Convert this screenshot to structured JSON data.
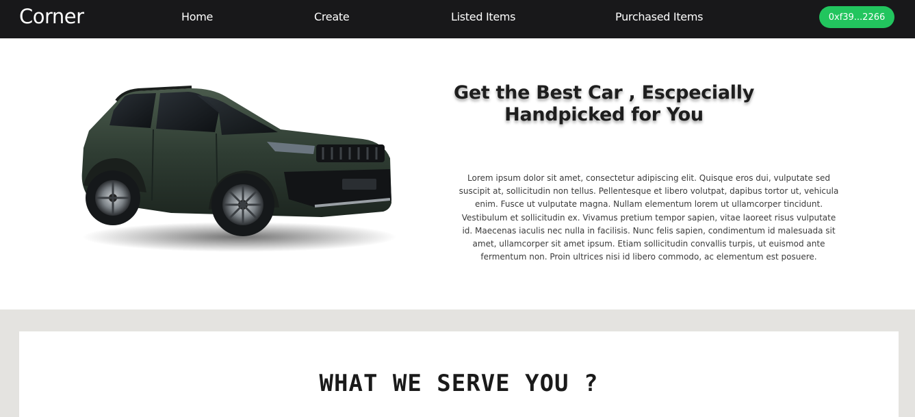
{
  "nav": {
    "brand": "Corner",
    "links": [
      "Home",
      "Create",
      "Listed Items",
      "Purchased Items"
    ],
    "wallet": "0xf39...2266",
    "accent_color": "#22c55e"
  },
  "hero": {
    "title": "Get the Best Car , Escpecially Handpicked for You",
    "image_icon": "suv-car-image",
    "body": "Lorem ipsum dolor sit amet, consectetur adipiscing elit. Quisque eros dui, vulputate sed suscipit at, sollicitudin non tellus. Pellentesque et libero volutpat, dapibus tortor ut, vehicula enim. Fusce ut vulputate magna. Nullam elementum lorem ut ullamcorper tincidunt. Vestibulum et sollicitudin ex. Vivamus pretium tempor sapien, vitae laoreet risus vulputate id. Maecenas iaculis nec nulla in facilisis. Nunc felis sapien, condimentum id malesuada sit amet, ullamcorper sit amet ipsum. Etiam sollicitudin convallis turpis, ut euismod ante fermentum non. Proin ultrices nisi id libero commodo, ac elementum est posuere."
  },
  "serve": {
    "title": "WHAT WE SERVE YOU ?"
  }
}
